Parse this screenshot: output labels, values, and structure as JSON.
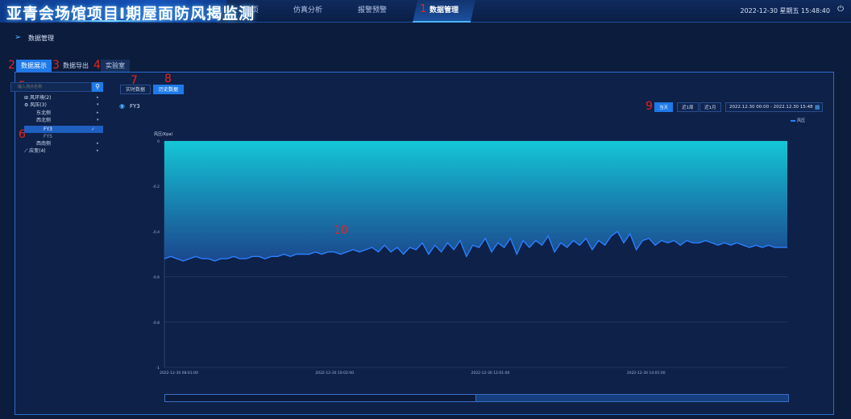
{
  "header": {
    "title": "亚青会场馆项目Ⅰ期屋面防风揭监测",
    "nav": [
      {
        "label": "首页"
      },
      {
        "label": "仿真分析"
      },
      {
        "label": "报警预警"
      },
      {
        "label": "数据管理"
      }
    ],
    "datetime": "2022-12-30  星期五  15:48:40"
  },
  "breadcrumb": {
    "label": "数据管理"
  },
  "tabs": [
    {
      "label": "数据展示"
    },
    {
      "label": "数据导出"
    },
    {
      "label": "实验室"
    }
  ],
  "markers": [
    "1",
    "2",
    "3",
    "4",
    "5",
    "6",
    "7",
    "8",
    "9",
    "10"
  ],
  "sidebar": {
    "search_placeholder": "输入测点名称",
    "tree": [
      {
        "label": "风环境(2)"
      },
      {
        "label": "风压(3)"
      },
      {
        "label": "东北侧"
      },
      {
        "label": "西北侧"
      },
      {
        "label": "FY3"
      },
      {
        "label": "FY5"
      },
      {
        "label": "西南侧"
      },
      {
        "label": "应变(4)"
      }
    ]
  },
  "mode_toggle": [
    {
      "label": "实时数据"
    },
    {
      "label": "历史数据"
    }
  ],
  "sensor": {
    "label": "FY3"
  },
  "range_buttons": [
    {
      "label": "当天"
    },
    {
      "label": "近1周"
    },
    {
      "label": "近1月"
    }
  ],
  "date_range": "2022.12.30 00:00  -  2022.12.30 15:48",
  "colors": {
    "accent": "#1f7ae8",
    "series": "#2b7fff",
    "area_top": "#14c8d8"
  },
  "chart_data": {
    "type": "area",
    "ylabel": "风压(Kpa)",
    "ylim": [
      -1,
      0
    ],
    "yticks": [
      "0",
      "-0.2",
      "-0.4",
      "-0.6",
      "-0.8",
      "-1"
    ],
    "xticks": [
      "2022-12-30 08:01:00",
      "2022-12-30 10:02:00",
      "2022-12-30 12:01:00",
      "2022-12-30 14:01:00"
    ],
    "grid": true,
    "legend_position": "top-right",
    "series": [
      {
        "name": "风压",
        "values": [
          -0.52,
          -0.51,
          -0.52,
          -0.53,
          -0.52,
          -0.51,
          -0.52,
          -0.52,
          -0.53,
          -0.52,
          -0.52,
          -0.51,
          -0.52,
          -0.52,
          -0.51,
          -0.51,
          -0.52,
          -0.51,
          -0.51,
          -0.5,
          -0.51,
          -0.5,
          -0.5,
          -0.5,
          -0.49,
          -0.5,
          -0.49,
          -0.49,
          -0.5,
          -0.49,
          -0.48,
          -0.49,
          -0.48,
          -0.47,
          -0.49,
          -0.46,
          -0.49,
          -0.47,
          -0.5,
          -0.47,
          -0.48,
          -0.45,
          -0.5,
          -0.46,
          -0.49,
          -0.45,
          -0.48,
          -0.44,
          -0.51,
          -0.46,
          -0.47,
          -0.43,
          -0.49,
          -0.45,
          -0.47,
          -0.43,
          -0.5,
          -0.44,
          -0.47,
          -0.44,
          -0.46,
          -0.42,
          -0.49,
          -0.45,
          -0.47,
          -0.44,
          -0.46,
          -0.43,
          -0.48,
          -0.44,
          -0.46,
          -0.42,
          -0.4,
          -0.45,
          -0.41,
          -0.48,
          -0.44,
          -0.43,
          -0.46,
          -0.44,
          -0.45,
          -0.44,
          -0.46,
          -0.44,
          -0.45,
          -0.45,
          -0.44,
          -0.45,
          -0.46,
          -0.45,
          -0.46,
          -0.45,
          -0.46,
          -0.47,
          -0.46,
          -0.47,
          -0.46,
          -0.47,
          -0.47,
          -0.47
        ]
      }
    ]
  }
}
